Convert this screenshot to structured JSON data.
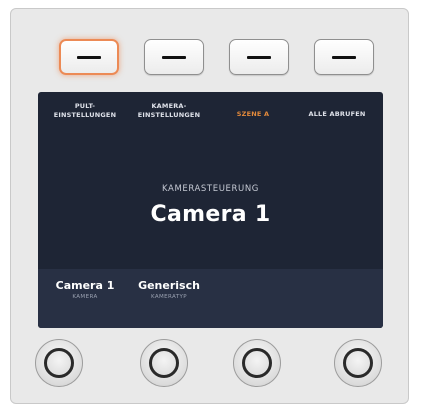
{
  "buttons": [
    {
      "name": "Pult-Einstellungen",
      "active": true
    },
    {
      "name": "Kamera-Einstellungen",
      "active": false
    },
    {
      "name": "Szene A",
      "active": false
    },
    {
      "name": "Alle abrufen",
      "active": false
    }
  ],
  "tabs": {
    "pult_line1": "PULT-",
    "pult_line2": "EINSTELLUNGEN",
    "kamera_line1": "KAMERA-",
    "kamera_line2": "EINSTELLUNGEN",
    "szene": "SZENE A",
    "alle": "ALLE ABRUFEN"
  },
  "screen": {
    "title": "KAMERASTEUERUNG",
    "main": "Camera 1"
  },
  "fields": [
    {
      "value": "Camera 1",
      "label": "KAMERA"
    },
    {
      "value": "Generisch",
      "label": "KAMERATYP"
    }
  ],
  "colors": {
    "accent": "#e2893b",
    "screen_bg": "#1e2535",
    "active_button_glow": "#ec8a55"
  }
}
